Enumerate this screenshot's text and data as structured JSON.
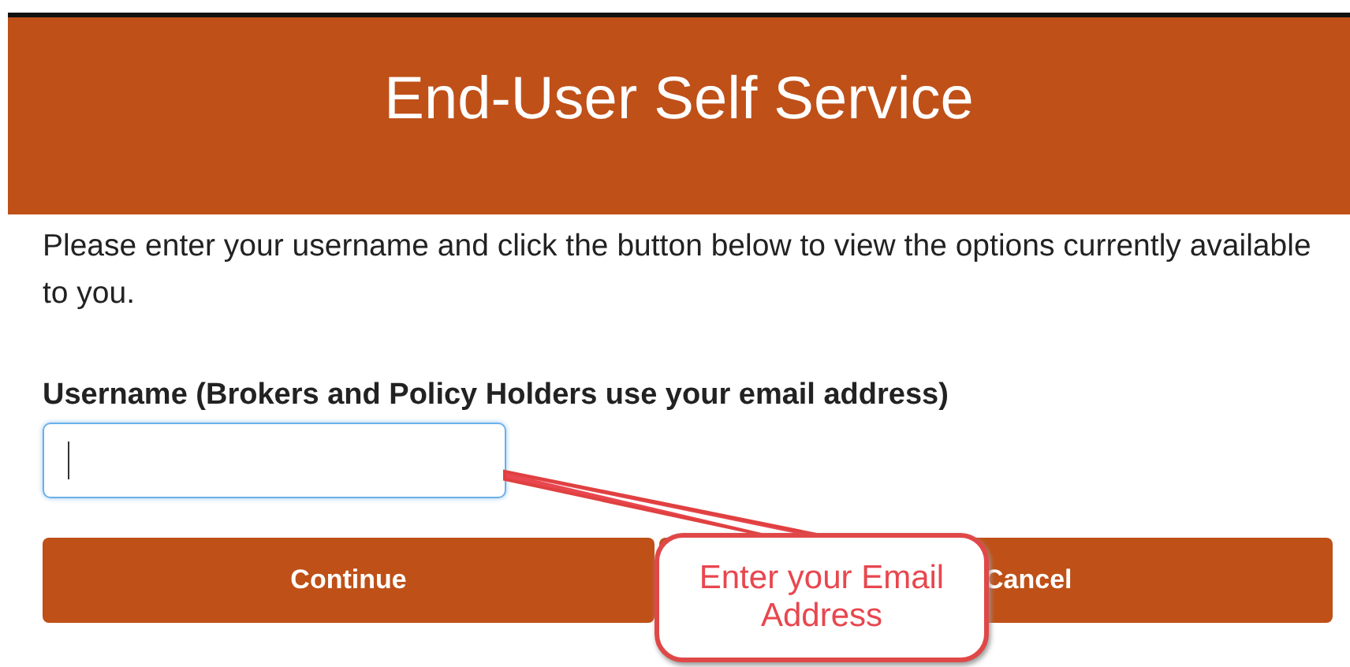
{
  "header": {
    "title": "End-User Self Service"
  },
  "intro": "Please enter your username and click the button below to view the options currently available to you.",
  "username_field": {
    "label": "Username (Brokers and Policy Holders use your email address)",
    "focused": true
  },
  "buttons": [
    {
      "label": "Continue"
    },
    {
      "label": "Cancel"
    }
  ],
  "callout": {
    "text": "Enter your Email Address"
  }
}
